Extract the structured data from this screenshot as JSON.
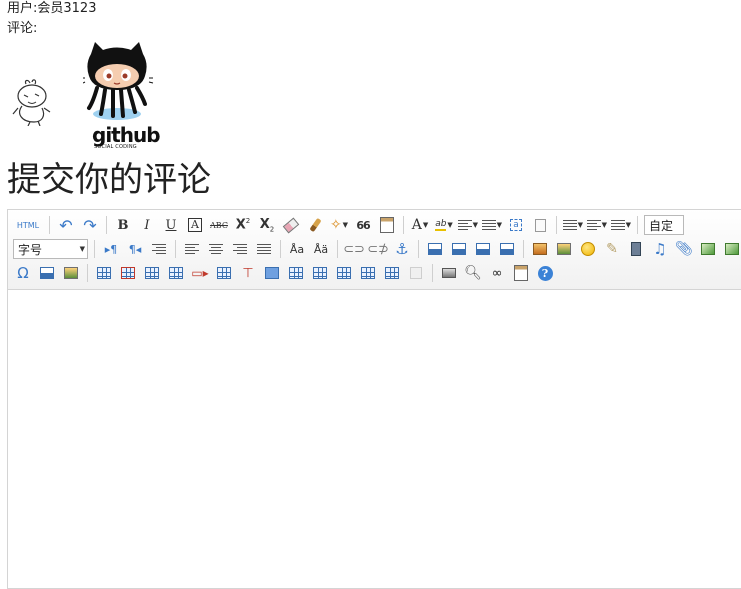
{
  "user": {
    "label": "用户:",
    "name": "会员3123"
  },
  "comment_label": "评论:",
  "heading": "提交你的评论",
  "github_logo": {
    "wordmark": "github",
    "tagline": "SOCIAL CODING"
  },
  "toolbar": {
    "html_label": "HTML",
    "bold": "B",
    "italic": "I",
    "underline": "U",
    "font_border": "A",
    "strikethrough": "ABC",
    "superscript_base": "X",
    "superscript_mark": "2",
    "subscript_base": "X",
    "subscript_mark": "2",
    "blockquote": "66",
    "fore_color": "A",
    "back_color": "ab",
    "font_size_placeholder": "字号",
    "paragraph_partial": "自定"
  },
  "icons": {
    "undo": "undo-icon",
    "redo": "redo-icon",
    "eraser": "eraser-icon",
    "brush": "format-brush-icon",
    "anchor": "anchor-icon",
    "link": "link-icon",
    "unlink": "unlink-icon",
    "emotion": "smiley-icon",
    "music": "music-icon",
    "attachment": "paperclip-icon",
    "special_char": "omega-icon",
    "print": "printer-icon",
    "preview": "preview-icon",
    "search": "binoculars-icon",
    "help": "help-icon"
  },
  "colors": {
    "toolbar_bg": "#f1f1f1",
    "border": "#d4d4d4",
    "icon_blue": "#3a79c8"
  }
}
